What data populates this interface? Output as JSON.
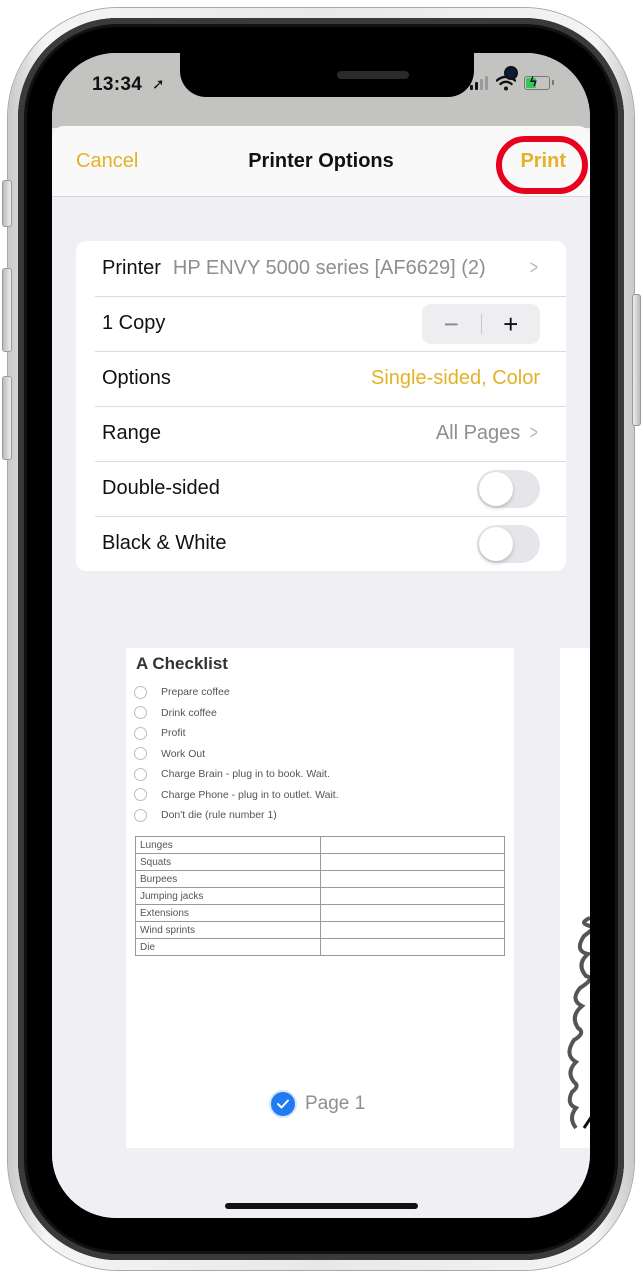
{
  "status_bar": {
    "time": "13:34",
    "location_icon": "location-arrow-icon",
    "signal_icon": "cellular-signal-icon",
    "wifi_icon": "wifi-icon",
    "battery_icon": "battery-charging-icon",
    "battery_color": "#34c759"
  },
  "nav": {
    "cancel_label": "Cancel",
    "title": "Printer Options",
    "print_label": "Print",
    "accent_color": "#e3b227",
    "annotation_color": "#e8001f"
  },
  "settings": {
    "printer": {
      "label": "Printer",
      "value": "HP ENVY 5000 series [AF6629] (2)"
    },
    "copies": {
      "label": "1 Copy",
      "decrement": "−",
      "increment": "+",
      "count": 1
    },
    "options": {
      "label": "Options",
      "value": "Single-sided, Color"
    },
    "range": {
      "label": "Range",
      "value": "All Pages"
    },
    "double_sided": {
      "label": "Double-sided",
      "on": false
    },
    "black_white": {
      "label": "Black & White",
      "on": false
    }
  },
  "preview": {
    "doc_title": "A Checklist",
    "checklist": [
      "Prepare coffee",
      "Drink coffee",
      "Profit",
      "Work Out",
      "Charge Brain - plug in to book. Wait.",
      "Charge Phone - plug in to outlet. Wait.",
      "Don't die (rule number 1)"
    ],
    "table_rows": [
      "Lunges",
      "Squats",
      "Burpees",
      "Jumping jacks",
      "Extensions",
      "Wind sprints",
      "Die"
    ],
    "page_label": "Page 1",
    "page_selected": true
  }
}
